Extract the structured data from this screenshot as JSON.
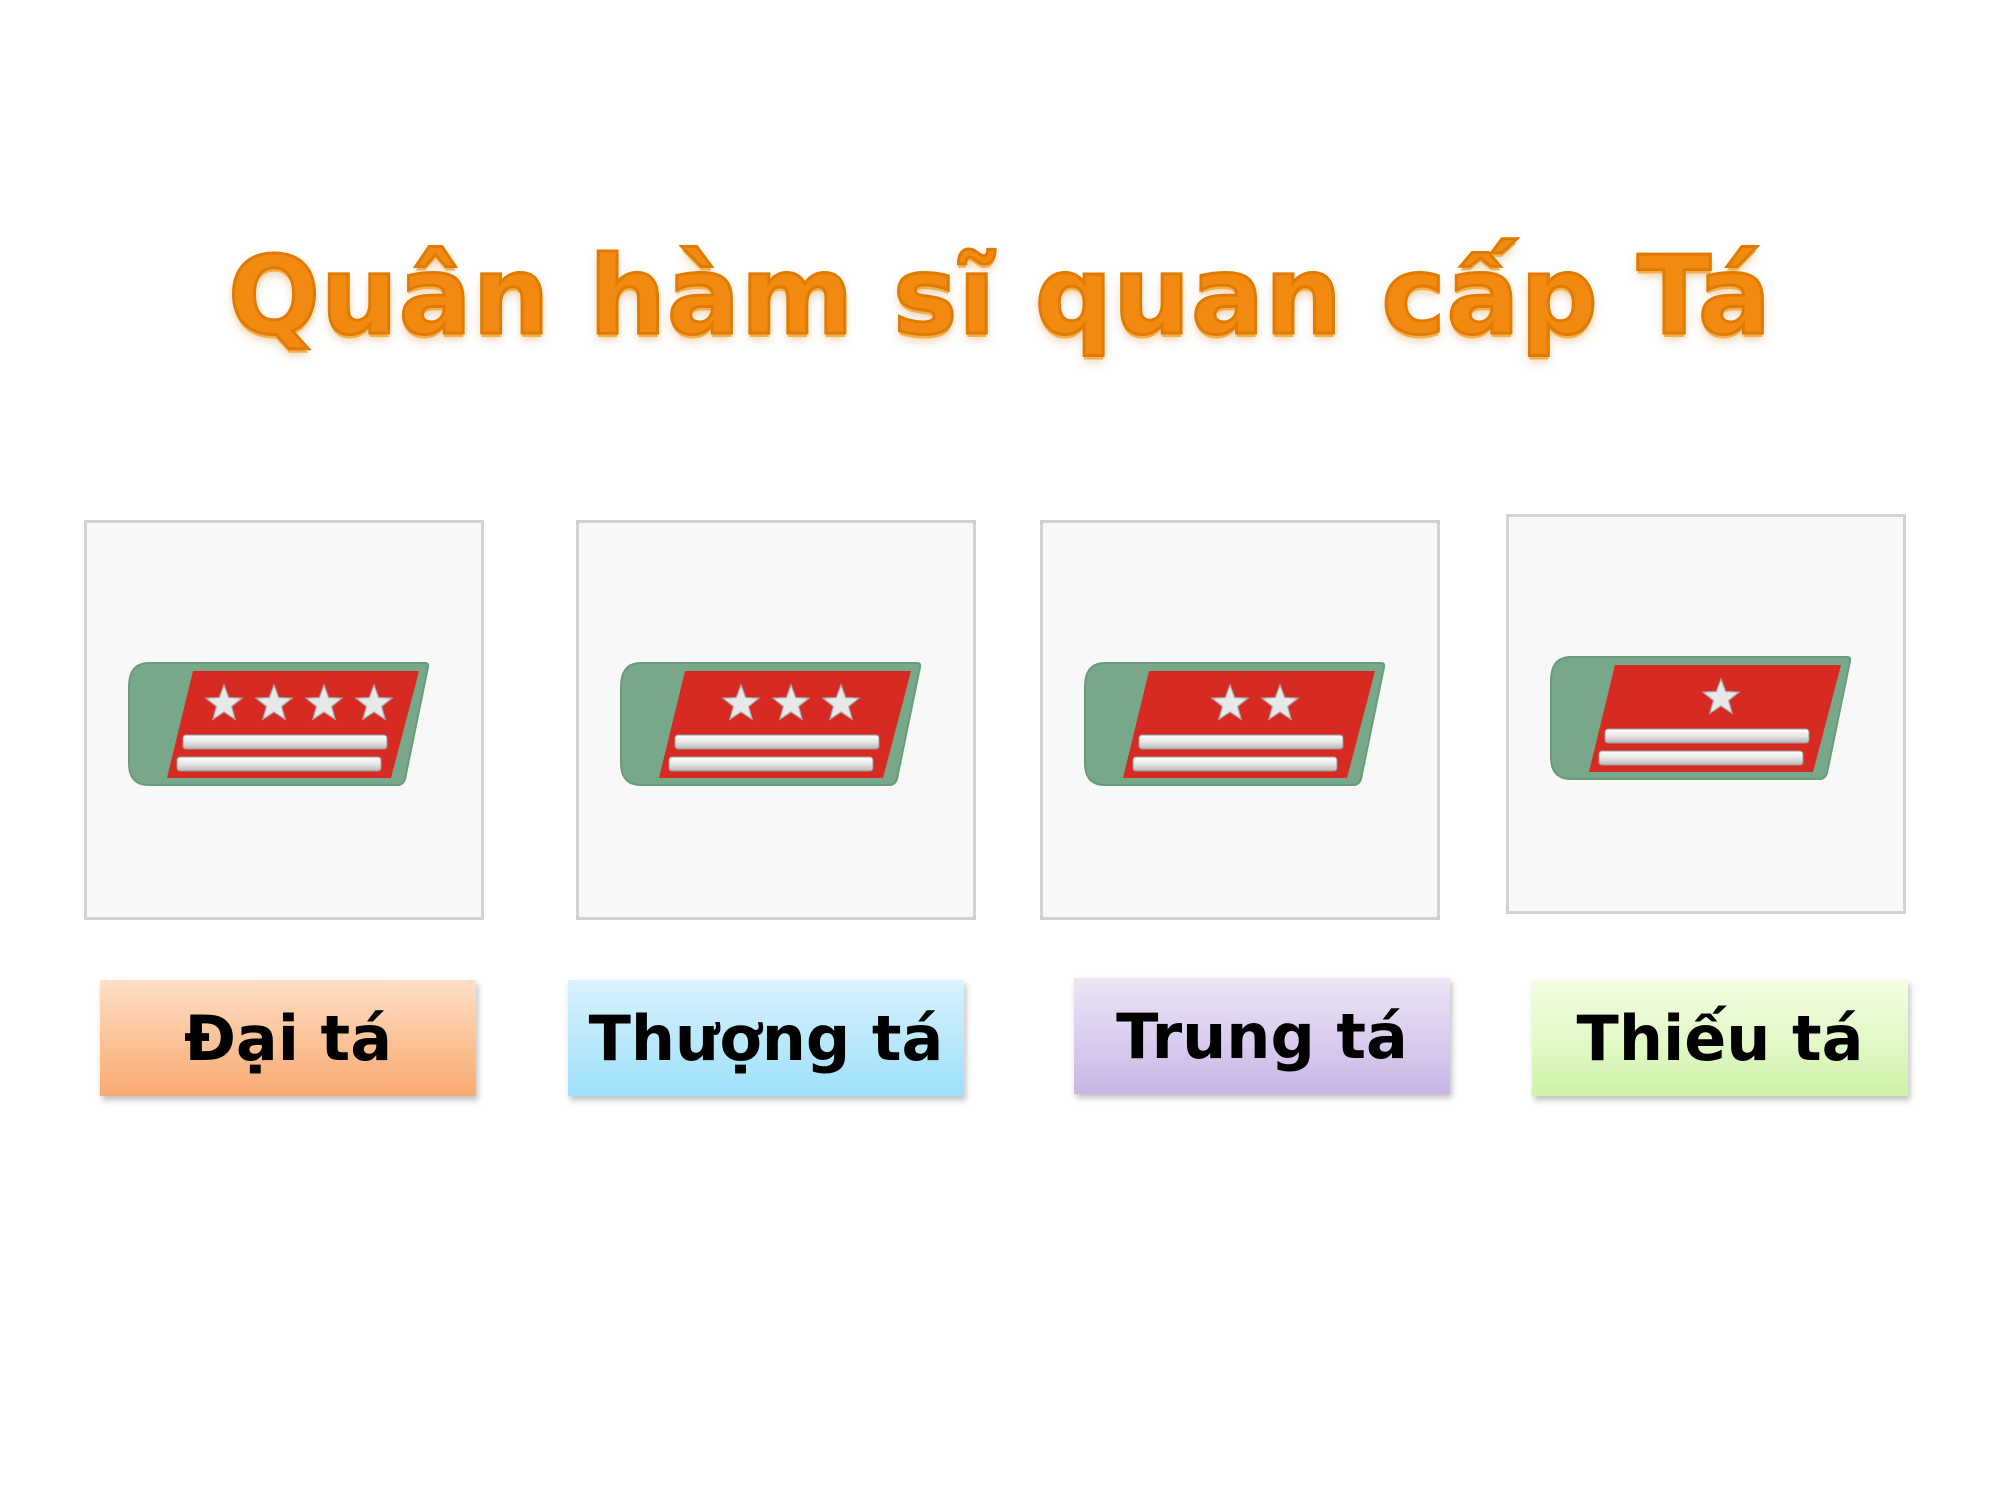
{
  "title": "Quân hàm sĩ quan cấp Tá",
  "colors": {
    "title": "#f28a12",
    "insignia_green": "#78a88a",
    "insignia_red": "#d62a22",
    "star": "#e8e8e8"
  },
  "ranks": [
    {
      "label": "Đại tá",
      "stars": 4,
      "bars": 2,
      "icon": "rank-insignia-4-stars-icon",
      "label_color": "#fbc195"
    },
    {
      "label": "Thượng tá",
      "stars": 3,
      "bars": 2,
      "icon": "rank-insignia-3-stars-icon",
      "label_color": "#b8e8fb"
    },
    {
      "label": "Trung tá",
      "stars": 2,
      "bars": 2,
      "icon": "rank-insignia-2-stars-icon",
      "label_color": "#d9ccee"
    },
    {
      "label": "Thiếu tá",
      "stars": 1,
      "bars": 2,
      "icon": "rank-insignia-1-star-icon",
      "label_color": "#e2f9c7"
    }
  ]
}
